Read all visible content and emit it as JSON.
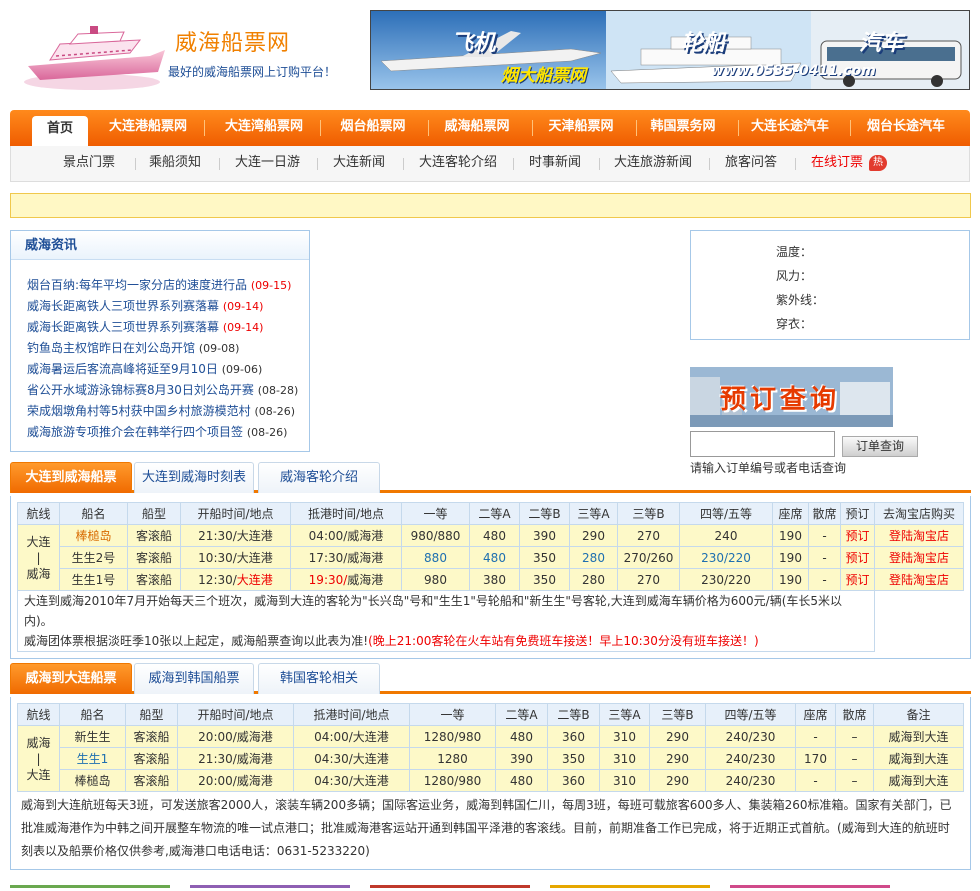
{
  "site": {
    "title": "威海船票网",
    "slogan": "最好的威海船票网上订购平台！"
  },
  "banner": {
    "plane": "飞机",
    "ship": "轮船",
    "bus": "汽车",
    "brand": "烟大船票网",
    "phone": "www.0535-0411.com"
  },
  "nav_main": [
    "首页",
    "大连港船票网",
    "大连湾船票网",
    "烟台船票网",
    "威海船票网",
    "天津船票网",
    "韩国票务网",
    "大连长途汽车",
    "烟台长途汽车"
  ],
  "nav_sub": [
    "景点门票",
    "乘船须知",
    "大连一日游",
    "大连新闻",
    "大连客轮介绍",
    "时事新闻",
    "大连旅游新闻",
    "旅客问答",
    "在线订票"
  ],
  "hot_badge": "热",
  "news": {
    "title": "威海资讯",
    "items": [
      {
        "text": "烟台百纳:每年平均一家分店的速度进行品",
        "date": "(09-15)",
        "red": true
      },
      {
        "text": "威海长距离铁人三项世界系列赛落幕",
        "date": "(09-14)",
        "red": true
      },
      {
        "text": "威海长距离铁人三项世界系列赛落幕",
        "date": "(09-14)",
        "red": true
      },
      {
        "text": "钓鱼岛主权馆昨日在刘公岛开馆",
        "date": "(09-08)",
        "red": false
      },
      {
        "text": "威海暑运后客流高峰将延至9月10日",
        "date": "(09-06)",
        "red": false
      },
      {
        "text": "省公开水域游泳锦标赛8月30日刘公岛开赛",
        "date": "(08-28)",
        "red": false
      },
      {
        "text": "荣成烟墩角村等5村获中国乡村旅游模范村",
        "date": "(08-26)",
        "red": false
      },
      {
        "text": "威海旅游专项推介会在韩举行四个项目签",
        "date": "(08-26)",
        "red": false
      }
    ]
  },
  "weather": {
    "temp": "温度：",
    "wind": "风力：",
    "uv": "紫外线：",
    "dress": "穿衣："
  },
  "order": {
    "image_text": "预订查询",
    "button": "订单查询",
    "hint": "请输入订单编号或者电话查询",
    "placeholder": ""
  },
  "section1": {
    "tabs": [
      "大连到威海船票",
      "大连到威海时刻表",
      "威海客轮介绍"
    ],
    "headers": [
      "航线",
      "船名",
      "船型",
      "开船时间/地点",
      "抵港时间/地点",
      "一等",
      "二等A",
      "二等B",
      "三等A",
      "三等B",
      "四等/五等",
      "座席",
      "散席",
      "预订",
      "去淘宝店购买"
    ],
    "route": [
      "大连",
      "|",
      "威海"
    ],
    "rows": [
      {
        "ship": "棒槌岛",
        "type": "客滚船",
        "depart": "21:30/大连港",
        "arrive": "04:00/威海港",
        "c1": "980/880",
        "c2a": "480",
        "c2b": "390",
        "c3a": "290",
        "c3b": "270",
        "c4": "240",
        "seat": "190",
        "loose": "-",
        "book": "预订",
        "shop": "登陆淘宝店"
      },
      {
        "ship": "生生2号",
        "type": "客滚船",
        "depart": "10:30/大连港",
        "arrive": "17:30/威海港",
        "c1": "880",
        "c2a": "480",
        "c2b": "350",
        "c3a": "280",
        "c3b": "270/260",
        "c4": "230/220",
        "seat": "190",
        "loose": "-",
        "book": "预订",
        "shop": "登陆淘宝店"
      },
      {
        "ship": "生生1号",
        "type": "客滚船",
        "depart_time": "12:30/",
        "depart_port": "大连港",
        "arrive_time": "19:30/",
        "arrive_port": "威海港",
        "c1": "980",
        "c2a": "380",
        "c2b": "350",
        "c3a": "280",
        "c3b": "270",
        "c4": "230/220",
        "seat": "190",
        "loose": "-",
        "book": "预订",
        "shop": "登陆淘宝店"
      }
    ],
    "note1": "大连到威海2010年7月开始每天三个班次，威海到大连的客轮为\"长兴岛\"号和\"生生1\"号轮船和\"新生生\"号客轮,大连到威海车辆价格为600元/辆(车长5米以内)。",
    "note2": "威海团体票根据淡旺季10张以上起定，威海船票查询以此表为准!",
    "note2_red": "(晚上21:00客轮在火车站有免费班车接送！早上10:30分没有班车接送！)"
  },
  "section2": {
    "tabs": [
      "威海到大连船票",
      "威海到韩国船票",
      "韩国客轮相关"
    ],
    "headers": [
      "航线",
      "船名",
      "船型",
      "开船时间/地点",
      "抵港时间/地点",
      "一等",
      "二等A",
      "二等B",
      "三等A",
      "三等B",
      "四等/五等",
      "座席",
      "散席",
      "备注"
    ],
    "route": [
      "威海",
      "|",
      "大连"
    ],
    "rows": [
      {
        "ship": "新生生",
        "type": "客滚船",
        "depart": "20:00/威海港",
        "arrive": "04:00/大连港",
        "c1": "1280/980",
        "c2a": "480",
        "c2b": "360",
        "c3a": "310",
        "c3b": "290",
        "c4": "240/230",
        "seat": "-",
        "loose": "–",
        "note": "威海到大连"
      },
      {
        "ship": "生生1",
        "type": "客滚船",
        "depart": "21:30/威海港",
        "arrive": "04:30/大连港",
        "c1": "1280",
        "c2a": "390",
        "c2b": "350",
        "c3a": "310",
        "c3b": "290",
        "c4": "240/230",
        "seat": "170",
        "loose": "–",
        "note": "威海到大连"
      },
      {
        "ship": "棒槌岛",
        "type": "客滚船",
        "depart": "20:00/威海港",
        "arrive": "04:30/大连港",
        "c1": "1280/980",
        "c2a": "480",
        "c2b": "360",
        "c3a": "310",
        "c3b": "290",
        "c4": "240/230",
        "seat": "-",
        "loose": "–",
        "note": "威海到大连"
      }
    ],
    "note": "威海到大连航班每天3班，可发送旅客2000人，滚装车辆200多辆；国际客运业务，威海到韩国仁川，每周3班，每班可载旅客600多人、集装箱260标准箱。国家有关部门，已批准威海港作为中韩之间开展整车物流的唯一试点港口；批准威海港客运站开通到韩国平泽港的客滚线。目前，前期准备工作已完成，将于近期正式首航。(威海到大连的航班时刻表以及船票价格仅供参考,威海港口电话电话：0631-5233220)"
  },
  "colors": {
    "accent": "#f07800",
    "link_blue": "#1e4e96",
    "row_yellow": "#fdf9c8",
    "header_blue": "#e7f0fa",
    "red": "#ee0000"
  }
}
